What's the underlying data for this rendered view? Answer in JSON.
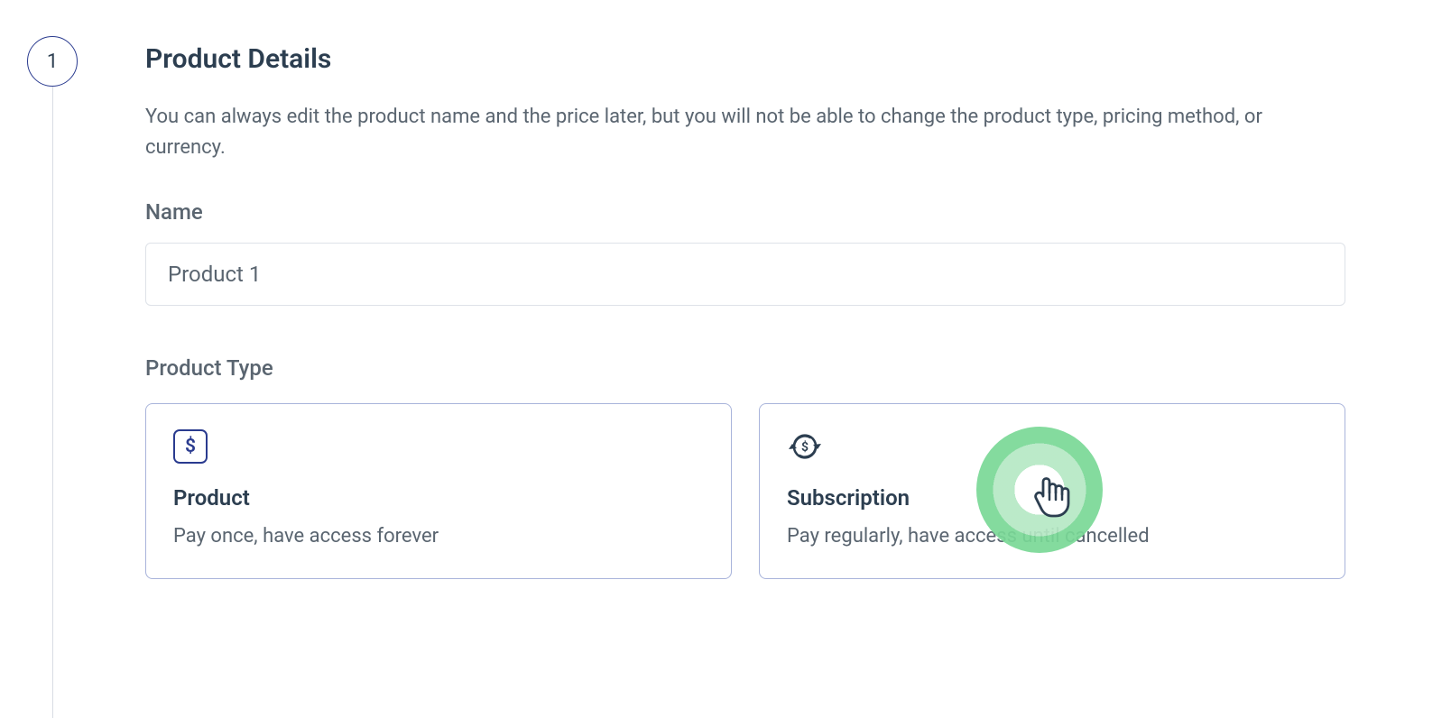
{
  "step": {
    "number": "1",
    "title": "Product Details",
    "description": "You can always edit the product name and the price later, but you will not be able to change the product type, pricing method, or currency."
  },
  "fields": {
    "name": {
      "label": "Name",
      "value": "Product 1"
    },
    "productType": {
      "label": "Product Type",
      "options": [
        {
          "icon": "dollar-box-icon",
          "title": "Product",
          "description": "Pay once, have access forever"
        },
        {
          "icon": "subscription-cycle-icon",
          "title": "Subscription",
          "description": "Pay regularly, have access until cancelled"
        }
      ]
    }
  }
}
